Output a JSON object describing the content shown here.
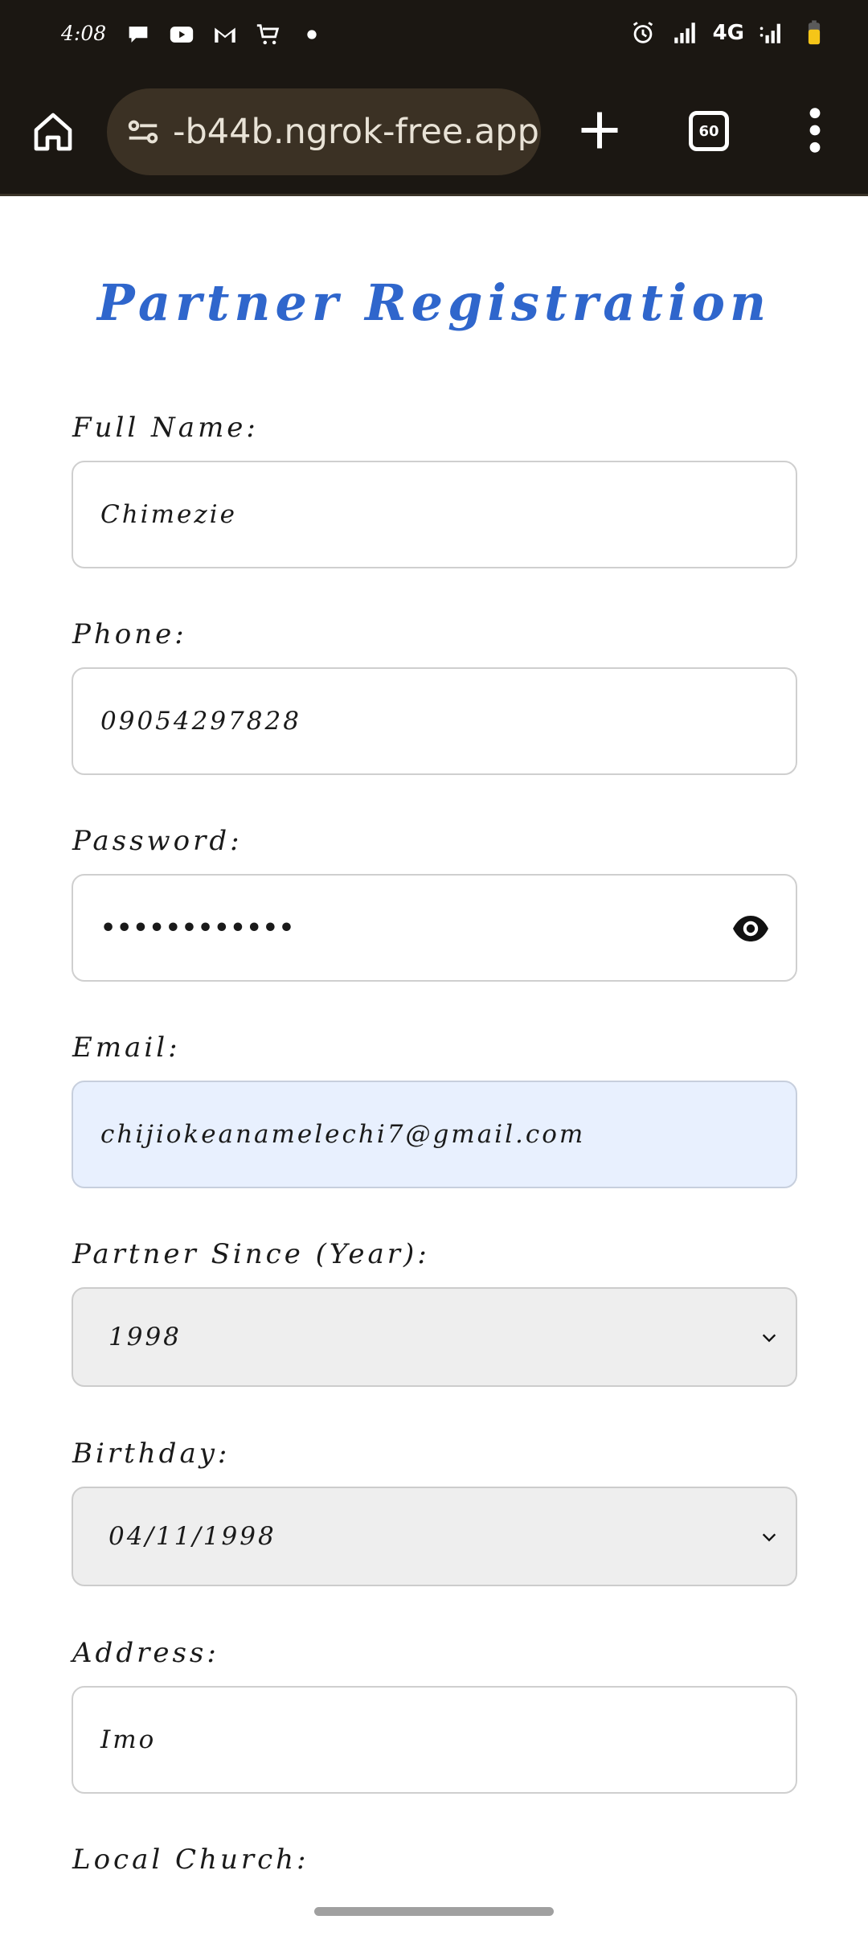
{
  "status_bar": {
    "time": "4:08",
    "network": "4G"
  },
  "browser": {
    "url": "-b44b.ngrok-free.app",
    "tab_count": "60"
  },
  "page": {
    "title": "Partner Registration"
  },
  "form": {
    "full_name": {
      "label": "Full Name:",
      "value": "Chimezie"
    },
    "phone": {
      "label": "Phone:",
      "value": "09054297828"
    },
    "password": {
      "label": "Password:",
      "value": "••••••••••••"
    },
    "email": {
      "label": "Email:",
      "value": "chijiokeanamelechi7@gmail.com"
    },
    "partner_since": {
      "label": "Partner Since (Year):",
      "value": "1998"
    },
    "birthday": {
      "label": "Birthday:",
      "value": "04/11/1998"
    },
    "address": {
      "label": "Address:",
      "value": "Imo"
    },
    "local_church": {
      "label": "Local Church:"
    }
  },
  "colors": {
    "title": "#2f66cc",
    "browser_bg": "#1b1712",
    "autofill_bg": "#e8f0fe",
    "select_bg": "#eeeeee"
  }
}
